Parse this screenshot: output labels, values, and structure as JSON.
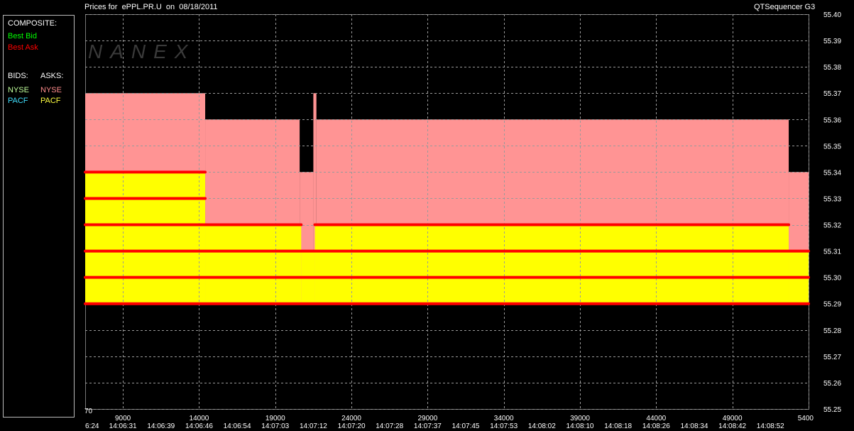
{
  "header": {
    "title": "Prices for  ePPL.PR.U  on  08/18/2011",
    "app_name": "QTSequencer G3"
  },
  "legend": {
    "composite_heading": "COMPOSITE:",
    "best_bid": "Best Bid",
    "best_ask": "Best Ask",
    "bids_heading": "BIDS:",
    "asks_heading": "ASKS:",
    "bid_nyse": "NYSE",
    "bid_pacf": "PACF",
    "ask_nyse": "NYSE",
    "ask_pacf": "PACF"
  },
  "watermark": "NANEX",
  "colors": {
    "background": "#000000",
    "ask_fill": "#ff9494",
    "bid_fill": "#ffff00",
    "bid_line": "#ff0000",
    "grid": "#9a9a9a",
    "best_bid_text": "#00ff00",
    "best_ask_text": "#ff0000",
    "nyse_bid_text": "#c0ff9c",
    "pacf_bid_text": "#40e0ff",
    "nyse_ask_text": "#ff8c8c",
    "pacf_ask_text": "#ffff40"
  },
  "chart_data": {
    "type": "area",
    "x_unit": "sequence",
    "xlim": [
      6524,
      54003
    ],
    "ylim": [
      55.25,
      55.4
    ],
    "y_ticks": [
      55.4,
      55.39,
      55.38,
      55.37,
      55.36,
      55.35,
      55.34,
      55.33,
      55.32,
      55.31,
      55.3,
      55.29,
      55.28,
      55.27,
      55.26,
      55.25
    ],
    "y_tick_labels": [
      "55.40",
      "55.39",
      "55.38",
      "55.37",
      "55.36",
      "55.35",
      "55.34",
      "55.33",
      "55.32",
      "55.31",
      "55.30",
      "55.29",
      "55.28",
      "55.27",
      "55.26",
      "55.25"
    ],
    "x_ticks": [
      {
        "x": 9000,
        "label": "9000"
      },
      {
        "x": 14000,
        "label": "14000"
      },
      {
        "x": 19000,
        "label": "19000"
      },
      {
        "x": 24000,
        "label": "24000"
      },
      {
        "x": 29000,
        "label": "29000"
      },
      {
        "x": 34000,
        "label": "34000"
      },
      {
        "x": 39000,
        "label": "39000"
      },
      {
        "x": 44000,
        "label": "44000"
      },
      {
        "x": 49000,
        "label": "49000"
      },
      {
        "x": 54000,
        "label": "5400"
      }
    ],
    "x_start_label": "70",
    "time_labels": [
      {
        "x": 6524,
        "label": "6:24"
      },
      {
        "x": 9000,
        "label": "14:06:31"
      },
      {
        "x": 11500,
        "label": "14:06:39"
      },
      {
        "x": 14000,
        "label": "14:06:46"
      },
      {
        "x": 16500,
        "label": "14:06:54"
      },
      {
        "x": 19000,
        "label": "14:07:03"
      },
      {
        "x": 21500,
        "label": "14:07:12"
      },
      {
        "x": 24000,
        "label": "14:07:20"
      },
      {
        "x": 26500,
        "label": "14:07:28"
      },
      {
        "x": 29000,
        "label": "14:07:37"
      },
      {
        "x": 31500,
        "label": "14:07:45"
      },
      {
        "x": 34000,
        "label": "14:07:53"
      },
      {
        "x": 36500,
        "label": "14:08:02"
      },
      {
        "x": 39000,
        "label": "14:08:10"
      },
      {
        "x": 41500,
        "label": "14:08:18"
      },
      {
        "x": 44000,
        "label": "14:08:26"
      },
      {
        "x": 46500,
        "label": "14:08:34"
      },
      {
        "x": 49000,
        "label": "14:08:42"
      },
      {
        "x": 51500,
        "label": "14:08:52"
      }
    ],
    "grid": true,
    "floor": 55.29,
    "series": [
      {
        "side": "ask",
        "steps": [
          {
            "x0": 6524,
            "x1": 14400,
            "price": 55.37
          },
          {
            "x0": 14400,
            "x1": 20600,
            "price": 55.36
          },
          {
            "x0": 20600,
            "x1": 21500,
            "price": 55.34
          },
          {
            "x0": 21500,
            "x1": 21700,
            "price": 55.37
          },
          {
            "x0": 21700,
            "x1": 52700,
            "price": 55.36
          },
          {
            "x0": 52700,
            "x1": 54003,
            "price": 55.34
          }
        ]
      },
      {
        "side": "bid",
        "steps": [
          {
            "x0": 6524,
            "x1": 14400,
            "price": 55.34
          },
          {
            "x0": 14400,
            "x1": 20700,
            "price": 55.32
          },
          {
            "x0": 20700,
            "x1": 21600,
            "price": 55.31
          },
          {
            "x0": 21600,
            "x1": 52700,
            "price": 55.32
          },
          {
            "x0": 52700,
            "x1": 54003,
            "price": 55.31
          }
        ]
      }
    ],
    "bid_levels": [
      {
        "price": 55.34,
        "x0": 6524,
        "x1": 14400
      },
      {
        "price": 55.33,
        "x0": 6524,
        "x1": 14400
      },
      {
        "price": 55.32,
        "x0": 6524,
        "x1": 20700
      },
      {
        "price": 55.32,
        "x0": 21600,
        "x1": 52700
      },
      {
        "price": 55.31,
        "x0": 6524,
        "x1": 54003
      },
      {
        "price": 55.3,
        "x0": 6524,
        "x1": 54003
      },
      {
        "price": 55.29,
        "x0": 6524,
        "x1": 54003
      }
    ]
  }
}
